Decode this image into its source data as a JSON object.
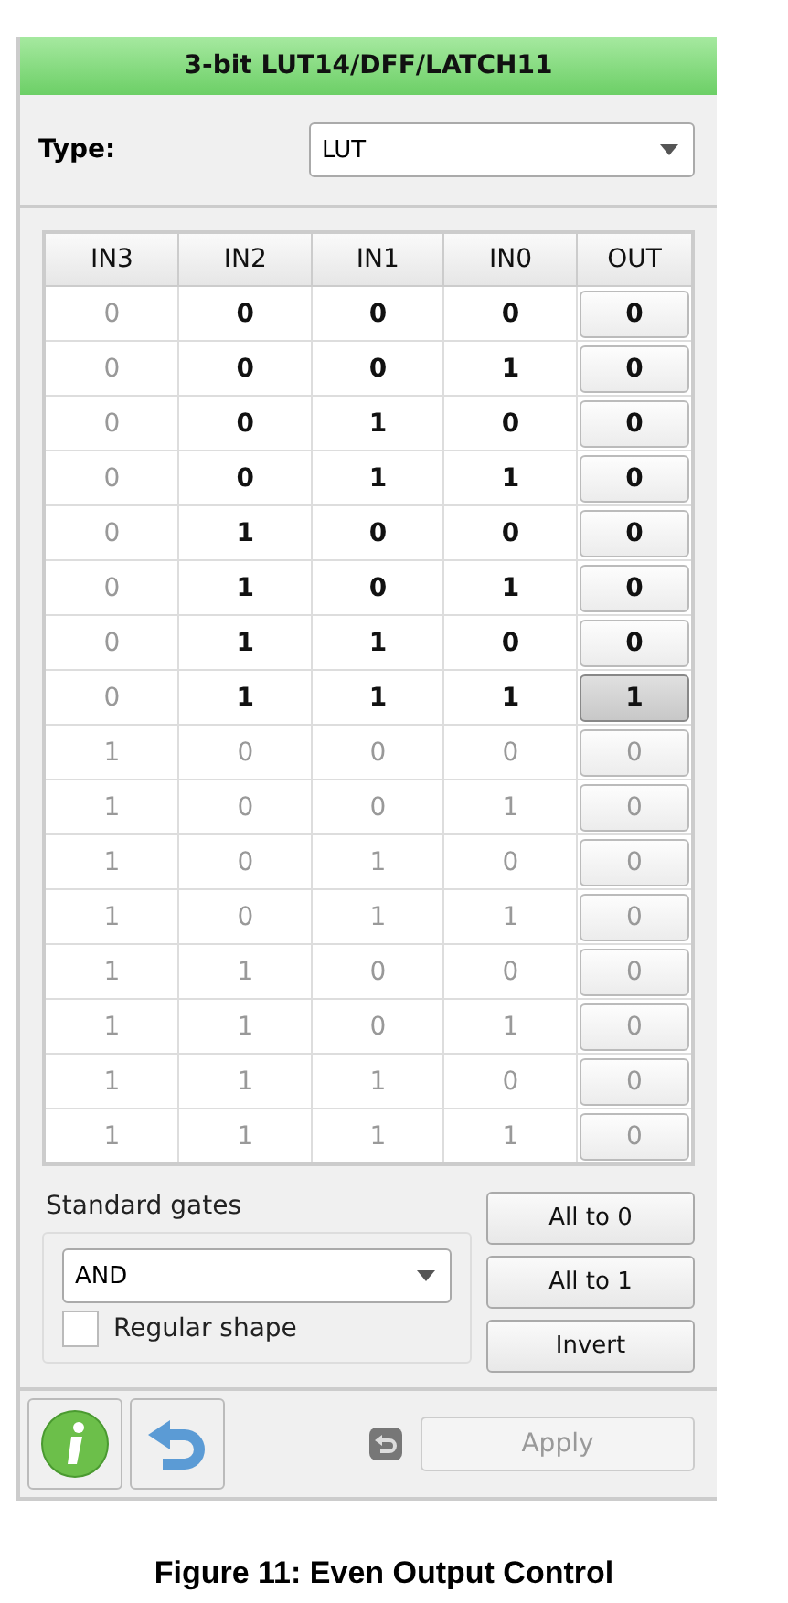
{
  "window": {
    "title": "3-bit LUT14/DFF/LATCH11"
  },
  "type_field": {
    "label": "Type:",
    "value": "LUT"
  },
  "table": {
    "columns": [
      "IN3",
      "IN2",
      "IN1",
      "IN0",
      "OUT"
    ],
    "rows": [
      {
        "cells": [
          {
            "value": "0",
            "dim": true
          },
          {
            "value": "0",
            "dim": false
          },
          {
            "value": "0",
            "dim": false
          },
          {
            "value": "0",
            "dim": false
          }
        ],
        "out": {
          "value": "0",
          "pressed": false,
          "disabled": false
        }
      },
      {
        "cells": [
          {
            "value": "0",
            "dim": true
          },
          {
            "value": "0",
            "dim": false
          },
          {
            "value": "0",
            "dim": false
          },
          {
            "value": "1",
            "dim": false
          }
        ],
        "out": {
          "value": "0",
          "pressed": false,
          "disabled": false
        }
      },
      {
        "cells": [
          {
            "value": "0",
            "dim": true
          },
          {
            "value": "0",
            "dim": false
          },
          {
            "value": "1",
            "dim": false
          },
          {
            "value": "0",
            "dim": false
          }
        ],
        "out": {
          "value": "0",
          "pressed": false,
          "disabled": false
        }
      },
      {
        "cells": [
          {
            "value": "0",
            "dim": true
          },
          {
            "value": "0",
            "dim": false
          },
          {
            "value": "1",
            "dim": false
          },
          {
            "value": "1",
            "dim": false
          }
        ],
        "out": {
          "value": "0",
          "pressed": false,
          "disabled": false
        }
      },
      {
        "cells": [
          {
            "value": "0",
            "dim": true
          },
          {
            "value": "1",
            "dim": false
          },
          {
            "value": "0",
            "dim": false
          },
          {
            "value": "0",
            "dim": false
          }
        ],
        "out": {
          "value": "0",
          "pressed": false,
          "disabled": false
        }
      },
      {
        "cells": [
          {
            "value": "0",
            "dim": true
          },
          {
            "value": "1",
            "dim": false
          },
          {
            "value": "0",
            "dim": false
          },
          {
            "value": "1",
            "dim": false
          }
        ],
        "out": {
          "value": "0",
          "pressed": false,
          "disabled": false
        }
      },
      {
        "cells": [
          {
            "value": "0",
            "dim": true
          },
          {
            "value": "1",
            "dim": false
          },
          {
            "value": "1",
            "dim": false
          },
          {
            "value": "0",
            "dim": false
          }
        ],
        "out": {
          "value": "0",
          "pressed": false,
          "disabled": false
        }
      },
      {
        "cells": [
          {
            "value": "0",
            "dim": true
          },
          {
            "value": "1",
            "dim": false
          },
          {
            "value": "1",
            "dim": false
          },
          {
            "value": "1",
            "dim": false
          }
        ],
        "out": {
          "value": "1",
          "pressed": true,
          "disabled": false
        }
      },
      {
        "cells": [
          {
            "value": "1",
            "dim": true
          },
          {
            "value": "0",
            "dim": true
          },
          {
            "value": "0",
            "dim": true
          },
          {
            "value": "0",
            "dim": true
          }
        ],
        "out": {
          "value": "0",
          "pressed": false,
          "disabled": true
        }
      },
      {
        "cells": [
          {
            "value": "1",
            "dim": true
          },
          {
            "value": "0",
            "dim": true
          },
          {
            "value": "0",
            "dim": true
          },
          {
            "value": "1",
            "dim": true
          }
        ],
        "out": {
          "value": "0",
          "pressed": false,
          "disabled": true
        }
      },
      {
        "cells": [
          {
            "value": "1",
            "dim": true
          },
          {
            "value": "0",
            "dim": true
          },
          {
            "value": "1",
            "dim": true
          },
          {
            "value": "0",
            "dim": true
          }
        ],
        "out": {
          "value": "0",
          "pressed": false,
          "disabled": true
        }
      },
      {
        "cells": [
          {
            "value": "1",
            "dim": true
          },
          {
            "value": "0",
            "dim": true
          },
          {
            "value": "1",
            "dim": true
          },
          {
            "value": "1",
            "dim": true
          }
        ],
        "out": {
          "value": "0",
          "pressed": false,
          "disabled": true
        }
      },
      {
        "cells": [
          {
            "value": "1",
            "dim": true
          },
          {
            "value": "1",
            "dim": true
          },
          {
            "value": "0",
            "dim": true
          },
          {
            "value": "0",
            "dim": true
          }
        ],
        "out": {
          "value": "0",
          "pressed": false,
          "disabled": true
        }
      },
      {
        "cells": [
          {
            "value": "1",
            "dim": true
          },
          {
            "value": "1",
            "dim": true
          },
          {
            "value": "0",
            "dim": true
          },
          {
            "value": "1",
            "dim": true
          }
        ],
        "out": {
          "value": "0",
          "pressed": false,
          "disabled": true
        }
      },
      {
        "cells": [
          {
            "value": "1",
            "dim": true
          },
          {
            "value": "1",
            "dim": true
          },
          {
            "value": "1",
            "dim": true
          },
          {
            "value": "0",
            "dim": true
          }
        ],
        "out": {
          "value": "0",
          "pressed": false,
          "disabled": true
        }
      },
      {
        "cells": [
          {
            "value": "1",
            "dim": true
          },
          {
            "value": "1",
            "dim": true
          },
          {
            "value": "1",
            "dim": true
          },
          {
            "value": "1",
            "dim": true
          }
        ],
        "out": {
          "value": "0",
          "pressed": false,
          "disabled": true
        }
      }
    ]
  },
  "standard_gates": {
    "label": "Standard gates",
    "value": "AND",
    "checkbox": {
      "label": "Regular shape",
      "checked": false
    }
  },
  "buttons": [
    {
      "label": "All to 0"
    },
    {
      "label": "All to 1"
    },
    {
      "label": "Invert"
    }
  ],
  "apply": {
    "label": "Apply",
    "disabled": true
  },
  "caption": "Figure 11: Even Output Control"
}
